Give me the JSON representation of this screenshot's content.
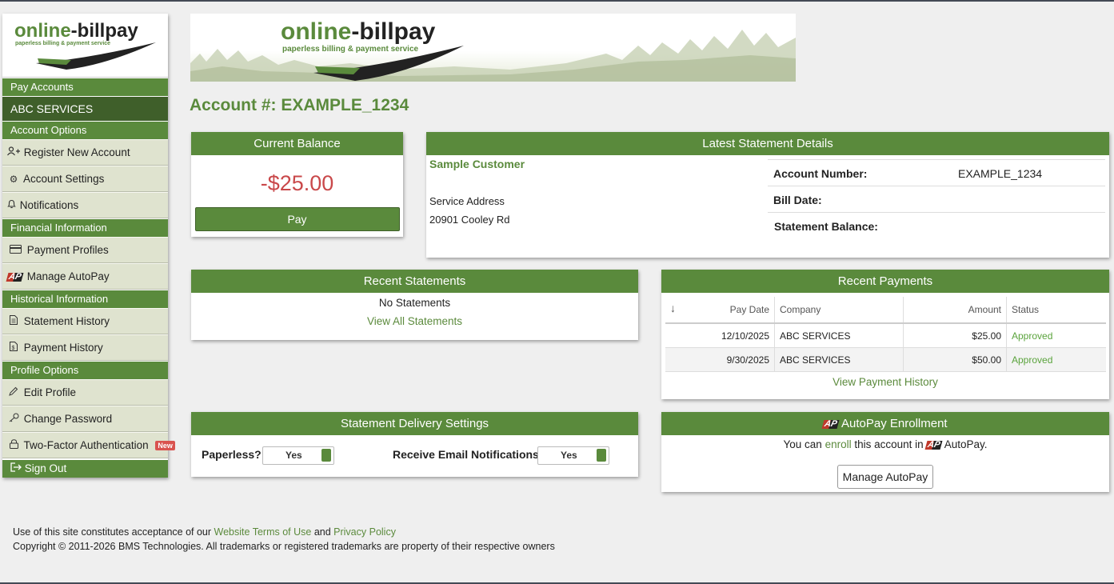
{
  "brand": {
    "name_part1": "online",
    "name_part2": "-billpay",
    "tagline": "paperless billing & payment service"
  },
  "sidebar": {
    "pay_accounts": "Pay Accounts",
    "active_account": "ABC SERVICES",
    "account_options": "Account Options",
    "register_new_account": "Register New Account",
    "account_settings": "Account Settings",
    "notifications": "Notifications",
    "financial_information": "Financial Information",
    "payment_profiles": "Payment Profiles",
    "manage_autopay": "Manage AutoPay",
    "historical_information": "Historical Information",
    "statement_history": "Statement History",
    "payment_history": "Payment History",
    "profile_options": "Profile Options",
    "edit_profile": "Edit Profile",
    "change_password": "Change Password",
    "two_factor": "Two-Factor Authentication",
    "new_badge": "New",
    "sign_out": "Sign Out"
  },
  "account_title": "Account #: EXAMPLE_1234",
  "current_balance": {
    "header": "Current Balance",
    "amount": "-$25.00",
    "pay_label": "Pay"
  },
  "latest_statement": {
    "header": "Latest Statement Details",
    "customer_name": "Sample Customer",
    "service_address_label": "Service Address",
    "service_address": "20901 Cooley Rd",
    "account_number_label": "Account Number:",
    "account_number": "EXAMPLE_1234",
    "bill_date_label": "Bill Date:",
    "bill_date": "",
    "statement_balance_label": "Statement Balance:",
    "statement_balance": ""
  },
  "recent_statements": {
    "header": "Recent Statements",
    "empty_text": "No Statements",
    "view_all": "View All Statements"
  },
  "recent_payments": {
    "header": "Recent Payments",
    "sort_icon": "↓",
    "columns": [
      "Pay Date",
      "Company",
      "Amount",
      "Status"
    ],
    "rows": [
      {
        "pay_date": "12/10/2025",
        "company": "ABC SERVICES",
        "amount": "$25.00",
        "status": "Approved"
      },
      {
        "pay_date": "9/30/2025",
        "company": "ABC SERVICES",
        "amount": "$50.00",
        "status": "Approved"
      }
    ],
    "view_history": "View Payment History"
  },
  "delivery_settings": {
    "header": "Statement Delivery Settings",
    "paperless_label": "Paperless?",
    "paperless_value": "Yes",
    "email_label": "Receive Email Notifications?",
    "email_value": "Yes"
  },
  "autopay": {
    "header": "AutoPay Enrollment",
    "logo_text": "AP",
    "text_before": "You can ",
    "enroll_link": "enroll",
    "text_after": " this account in ",
    "text_end": "AutoPay.",
    "button_label": "Manage AutoPay"
  },
  "footer": {
    "line1_prefix": "Use of this site constitutes acceptance of our ",
    "terms_link": "Website Terms of Use",
    "and": " and ",
    "privacy_link": "Privacy Policy",
    "copyright": "Copyright © 2011-2026 BMS Technologies. All trademarks or registered trademarks are property of their respective owners"
  },
  "colors": {
    "brand_green": "#5a8a3c",
    "dark_green": "#3f5f2a",
    "negative_red": "#c9484a",
    "approved_green": "#5aa33c"
  }
}
